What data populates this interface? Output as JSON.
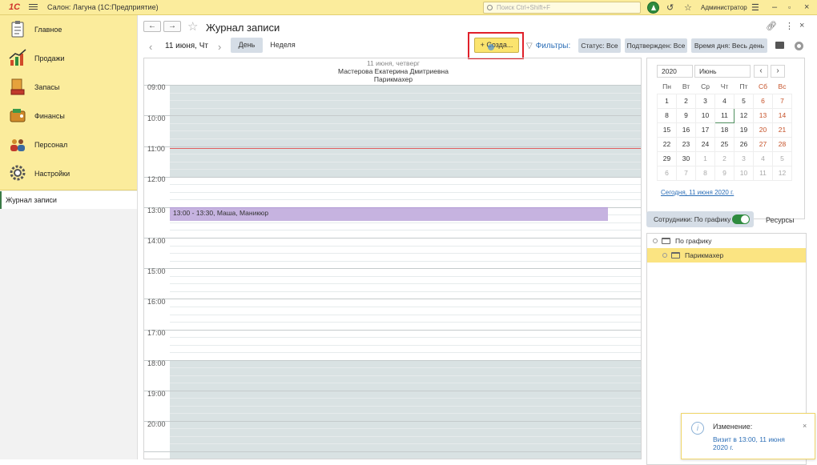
{
  "topbar": {
    "logo": "1С",
    "app_title": "Салон: Лагуна  (1С:Предприятие)",
    "search_placeholder": "Поиск Ctrl+Shift+F",
    "user": "Администратор"
  },
  "sidebar": {
    "sections": [
      {
        "label": "Главное",
        "icon": "clipboard-icon"
      },
      {
        "label": "Продажи",
        "icon": "sales-chart-icon"
      },
      {
        "label": "Запасы",
        "icon": "stock-box-icon"
      },
      {
        "label": "Финансы",
        "icon": "wallet-icon"
      },
      {
        "label": "Персонал",
        "icon": "people-icon"
      },
      {
        "label": "Настройки",
        "icon": "gear-icon"
      }
    ],
    "open_windows": [
      {
        "label": "Журнал записи"
      }
    ]
  },
  "page": {
    "title": "Журнал записи",
    "date": "11 июня, Чт",
    "view_day": "День",
    "view_week": "Неделя",
    "create": "+ Созда...",
    "filters_label": "Фильтры:",
    "filters": [
      {
        "label": "Статус: Все"
      },
      {
        "label": "Подтвержден: Все"
      },
      {
        "label": "Время дня: Весь день"
      }
    ]
  },
  "schedule": {
    "header_date": "11 июня, четверг",
    "employee": "Мастерова Екатерина Дмитриевна",
    "position": "Парикмахер",
    "hours": [
      "09:00",
      "10:00",
      "11:00",
      "12:00",
      "13:00",
      "14:00",
      "15:00",
      "16:00",
      "17:00",
      "18:00",
      "19:00",
      "20:00"
    ],
    "events": [
      {
        "text": "13:00 - 13:30, Маша, Маникюр"
      }
    ]
  },
  "calendar": {
    "year": "2020",
    "month": "Июнь",
    "weekdays": [
      "Пн",
      "Вт",
      "Ср",
      "Чт",
      "Пт",
      "Сб",
      "Вс"
    ],
    "weeks": [
      [
        "1",
        "2",
        "3",
        "4",
        "5",
        "6",
        "7"
      ],
      [
        "8",
        "9",
        "10",
        "11",
        "12",
        "13",
        "14"
      ],
      [
        "15",
        "16",
        "17",
        "18",
        "19",
        "20",
        "21"
      ],
      [
        "22",
        "23",
        "24",
        "25",
        "26",
        "27",
        "28"
      ],
      [
        "29",
        "30",
        "1",
        "2",
        "3",
        "4",
        "5"
      ],
      [
        "6",
        "7",
        "8",
        "9",
        "10",
        "11",
        "12"
      ]
    ],
    "today_link": "Сегодня, 11 июня 2020 г."
  },
  "resources": {
    "toggle_label": "Сотрудники: По графику",
    "tab_resources": "Ресурсы",
    "tree": [
      {
        "label": "По графику"
      },
      {
        "label": "Парикмахер"
      }
    ]
  },
  "toast": {
    "title": "Изменение:",
    "message": "Визит в 13:00, 11 июня 2020 г."
  },
  "colors": {
    "accent_yellow": "#fbec9c",
    "busy_band": "#d9e2e3",
    "event": "#c6b3e0",
    "link": "#2d6fb7",
    "highlight_red": "#e0202a"
  }
}
